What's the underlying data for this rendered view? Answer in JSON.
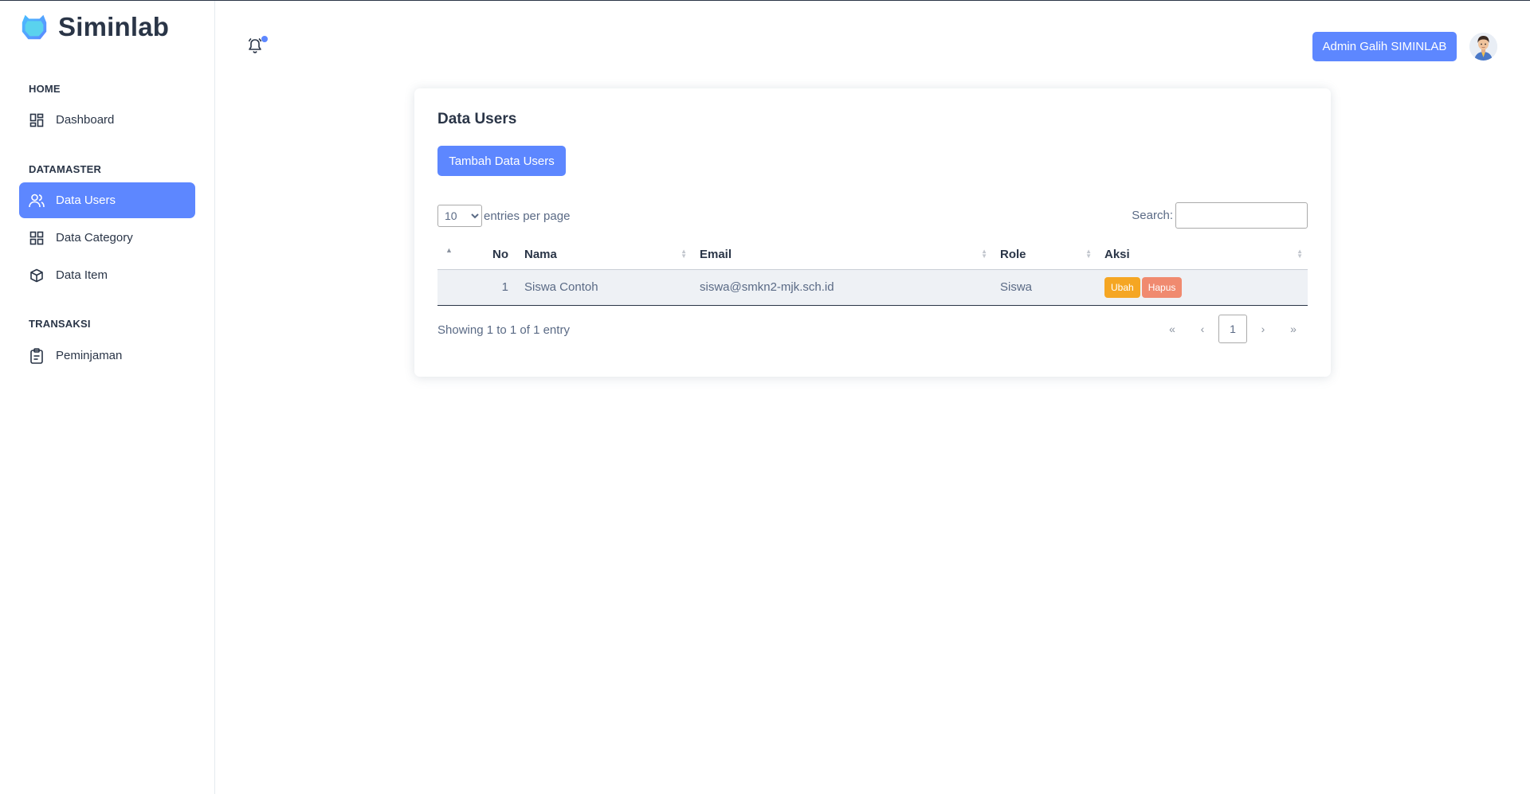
{
  "brand": {
    "name": "Siminlab"
  },
  "sidebar": {
    "sections": [
      {
        "label": "HOME"
      },
      {
        "label": "DATAMASTER"
      },
      {
        "label": "TRANSAKSI"
      }
    ],
    "items": [
      {
        "label": "Dashboard",
        "icon": "dashboard-icon"
      },
      {
        "label": "Data Users",
        "icon": "users-icon",
        "active": true
      },
      {
        "label": "Data Category",
        "icon": "category-icon"
      },
      {
        "label": "Data Item",
        "icon": "box-icon"
      },
      {
        "label": "Peminjaman",
        "icon": "clipboard-icon"
      }
    ]
  },
  "header": {
    "user_button": "Admin Galih SIMINLAB",
    "notification_icon": "bell-icon"
  },
  "card": {
    "title": "Data Users",
    "add_button": "Tambah Data Users",
    "entries_select": {
      "selected": "10",
      "options": [
        "10"
      ]
    },
    "entries_label": "entries per page",
    "search_label": "Search:",
    "search_value": "",
    "table": {
      "columns": [
        "No",
        "Nama",
        "Email",
        "Role",
        "Aksi"
      ],
      "rows": [
        {
          "no": "1",
          "nama": "Siswa Contoh",
          "email": "siswa@smkn2-mjk.sch.id",
          "role": "Siswa"
        }
      ],
      "actions": {
        "edit": "Ubah",
        "delete": "Hapus"
      }
    },
    "showing": "Showing 1 to 1 of 1 entry",
    "pagination": {
      "first": "«",
      "prev": "‹",
      "current": "1",
      "next": "›",
      "last": "»"
    }
  },
  "colors": {
    "primary": "#5d87ff",
    "warning": "#f5a623",
    "danger": "#f08a6f",
    "text": "#2a3547",
    "muted": "#5a6a85"
  }
}
